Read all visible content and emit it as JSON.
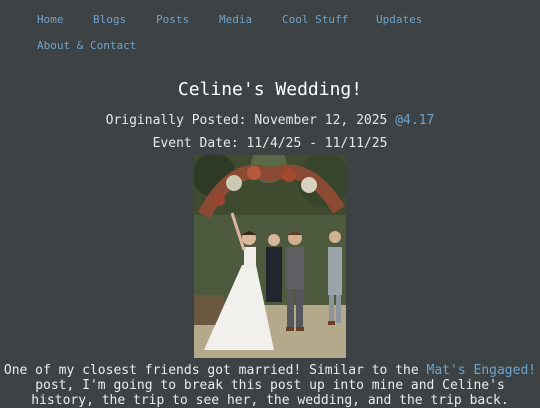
{
  "nav": {
    "home": "Home",
    "blogs": "Blogs",
    "posts": "Posts",
    "media": "Media",
    "cool_stuff": "Cool Stuff",
    "updates": "Updates",
    "about": "About & Contact"
  },
  "post": {
    "title": "Celine's Wedding!",
    "posted_label": "Originally Posted: November 12, 2025",
    "posted_time": "@4.17",
    "event_label": "Event Date: 11/4/25 - 11/11/25",
    "photo_icon": "wedding-photo",
    "body_line1_prefix": "One of my closest friends got married! Similar to the",
    "body_link": "Mat's Engaged!",
    "body_line2": "post, I'm going to break this post up into mine and Celine's",
    "body_line3": "history, the trip to see her, the wedding, and the trip back."
  },
  "colors": {
    "background": "#3d4244",
    "link": "#6fa3cc",
    "text": "#e8e8e8"
  }
}
